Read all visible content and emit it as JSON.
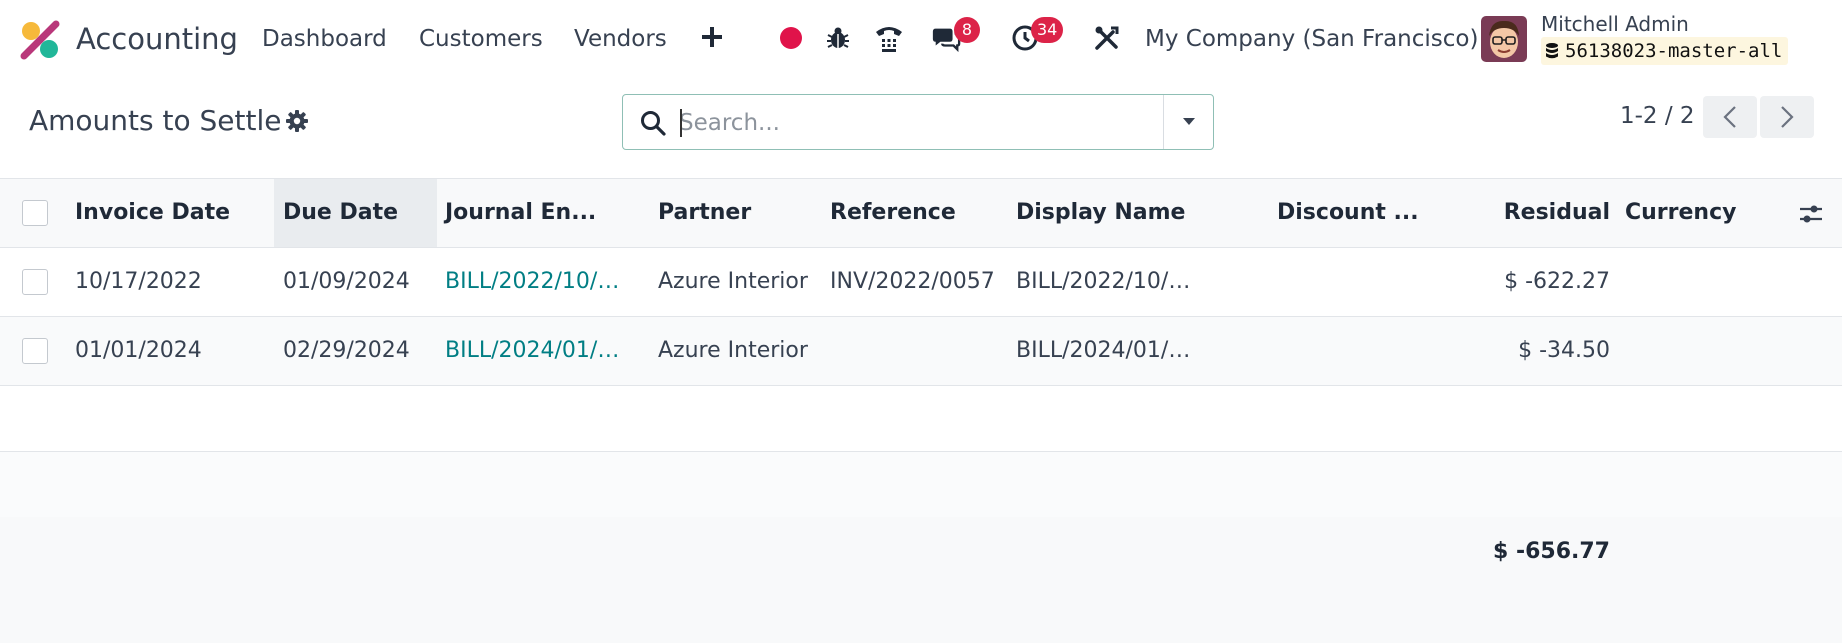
{
  "navbar": {
    "app_name": "Accounting",
    "menu": [
      "Dashboard",
      "Customers",
      "Vendors"
    ],
    "message_count": "8",
    "activity_count": "34",
    "company": "My Company (San Francisco)",
    "user_name": "Mitchell Admin",
    "database": "56138023-master-all"
  },
  "control_panel": {
    "title": "Amounts to Settle",
    "search_placeholder": "Search...",
    "pager": "1-2 / 2"
  },
  "table": {
    "columns": [
      "Invoice Date",
      "Due Date",
      "Journal En...",
      "Partner",
      "Reference",
      "Display Name",
      "Discount ...",
      "Residual",
      "Currency"
    ],
    "rows": [
      {
        "invoice_date": "10/17/2022",
        "due_date": "01/09/2024",
        "journal_entry": "BILL/2022/10/…",
        "partner": "Azure Interior",
        "reference": "INV/2022/0057",
        "display_name": "BILL/2022/10/…",
        "discount": "",
        "residual": "$ -622.27",
        "currency": ""
      },
      {
        "invoice_date": "01/01/2024",
        "due_date": "02/29/2024",
        "journal_entry": "BILL/2024/01/…",
        "partner": "Azure Interior",
        "reference": "",
        "display_name": "BILL/2024/01/…",
        "discount": "",
        "residual": "$ -34.50",
        "currency": ""
      }
    ],
    "total_residual": "$ -656.77"
  },
  "colors": {
    "link": "#017e84",
    "badge": "#dc2348",
    "record": "#e0134a"
  }
}
